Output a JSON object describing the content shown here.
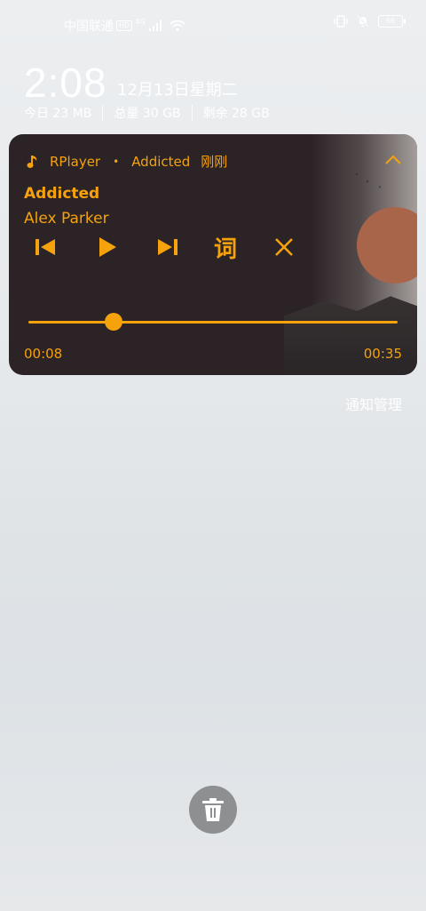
{
  "status_bar": {
    "carrier": "中国联通",
    "hd_badge": "HD",
    "network": "4G",
    "battery": "66"
  },
  "lockscreen": {
    "time": "2:08",
    "date": "12月13日星期二",
    "today_usage": "今日 23 MB",
    "total": "总量 30 GB",
    "remaining": "剩余 28 GB"
  },
  "notification": {
    "app_name": "RPlayer",
    "separator": "•",
    "header_title": "Addicted",
    "header_time": "刚刚",
    "song_title": "Addicted",
    "artist": "Alex Parker",
    "lyrics_button": "词",
    "current_time": "00:08",
    "total_time": "00:35",
    "progress": 0.23,
    "accent_color": "#f5a20d",
    "icons": [
      "music-note-icon",
      "chevron-up-icon",
      "skip-previous-icon",
      "play-icon",
      "skip-next-icon",
      "close-icon"
    ]
  },
  "footer": {
    "manage_label": "通知管理",
    "trash_icon": "trash-icon"
  }
}
